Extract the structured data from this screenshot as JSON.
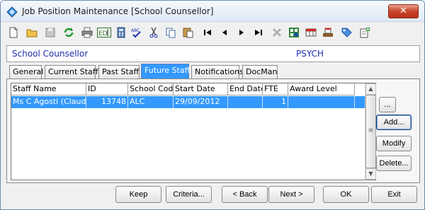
{
  "window": {
    "title": "Job Position Maintenance  [School Counsellor]",
    "close_label": "✕"
  },
  "toolbar": {
    "buttons": [
      {
        "name": "new-icon"
      },
      {
        "name": "open-folder-icon"
      },
      {
        "name": "save-icon"
      },
      {
        "name": "refresh-icon"
      },
      {
        "name": "print-icon"
      },
      {
        "name": "edit-field-icon"
      },
      {
        "name": "calculator-icon"
      },
      {
        "name": "spellcheck-icon"
      },
      {
        "name": "cut-icon"
      },
      {
        "name": "copy-icon"
      },
      {
        "name": "paste-icon"
      },
      {
        "name": "first-record-icon"
      },
      {
        "name": "previous-record-icon"
      },
      {
        "name": "next-record-icon"
      },
      {
        "name": "last-record-icon"
      },
      {
        "name": "delete-icon"
      },
      {
        "name": "find-icon"
      },
      {
        "name": "grid-view-icon"
      },
      {
        "name": "export-icon"
      },
      {
        "name": "tag-icon"
      },
      {
        "name": "add-note-icon"
      }
    ]
  },
  "header": {
    "position_title": "School Counsellor",
    "position_code": "PSYCH"
  },
  "tabs": [
    {
      "label": "General",
      "active": false
    },
    {
      "label": "Current Staff",
      "active": false
    },
    {
      "label": "Past Staff",
      "active": false
    },
    {
      "label": "Future Staff",
      "active": true
    },
    {
      "label": "Notifications",
      "active": false
    },
    {
      "label": "DocMan",
      "active": false
    }
  ],
  "grid": {
    "columns": [
      "Staff Name",
      "ID",
      "School Code",
      "Start Date",
      "End Date",
      "FTE",
      "Award Level"
    ],
    "rows": [
      {
        "staff_name": "Ms C Agosti (Claudia)",
        "id": "13748",
        "school_code": "ALC",
        "start_date": "29/09/2012",
        "end_date": "",
        "fte": "1",
        "award_level": ""
      }
    ]
  },
  "side_buttons": {
    "more": "...",
    "add": "Add...",
    "modify": "Modify",
    "delete": "Delete..."
  },
  "bottom_buttons": {
    "keep": "Keep",
    "criteria": "Criteria...",
    "back": "< Back",
    "next": "Next >",
    "ok": "OK",
    "exit": "Exit"
  },
  "colors": {
    "selection": "#3399ff",
    "header_text": "#1c2eb0"
  }
}
